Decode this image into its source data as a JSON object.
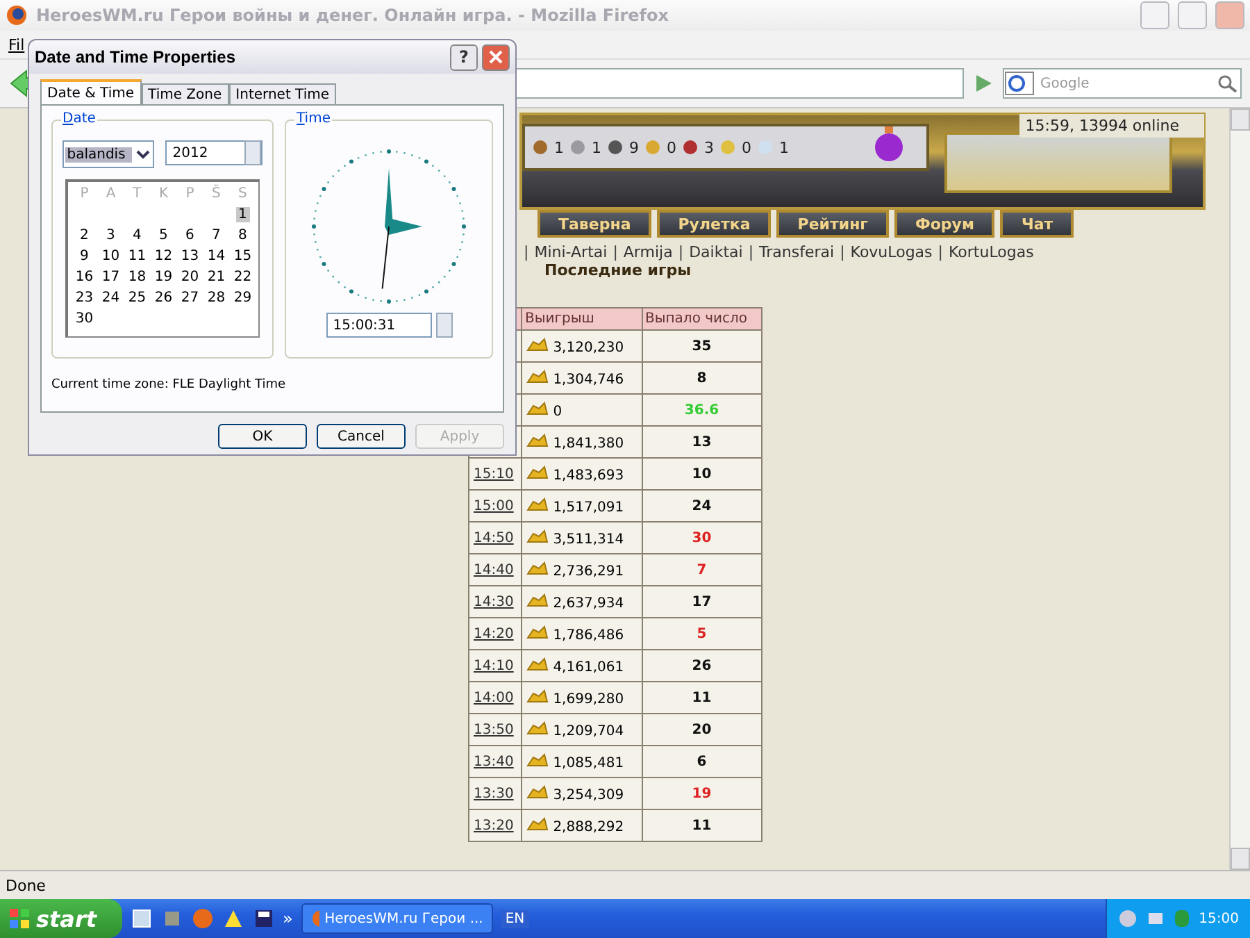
{
  "browser": {
    "title": "HeroesWM.ru Герои войны и денег. Онлайн игра. - Mozilla Firefox",
    "menu": [
      "Fil"
    ],
    "search": {
      "placeholder": "Google"
    },
    "status": "Done"
  },
  "site": {
    "resources": [
      "1",
      "1",
      "9",
      "0",
      "3",
      "0",
      "1"
    ],
    "online": "15:59, 13994 online",
    "nav": [
      "Таверна",
      "Рулетка",
      "Рейтинг",
      "Форум",
      "Чат"
    ],
    "link_separator": "|",
    "links": [
      "Mini-Artai",
      "Armija",
      "Daiktai",
      "Transferai",
      "KovuLogas",
      "KortuLogas"
    ],
    "heading": "Последние игры",
    "table": {
      "columns": [
        "Выигрыш",
        "Выпало число"
      ],
      "rows": [
        {
          "prize": "3,120,230",
          "number": "35",
          "color": "#111111"
        },
        {
          "prize": "1,304,746",
          "number": "8",
          "color": "#111111"
        },
        {
          "prize": "0",
          "number": "36.6",
          "color": "#33cc33"
        },
        {
          "prize": "1,841,380",
          "number": "13",
          "color": "#111111"
        },
        {
          "time": "15:10",
          "prize": "1,483,693",
          "number": "10",
          "color": "#111111"
        },
        {
          "time": "15:00",
          "prize": "1,517,091",
          "number": "24",
          "color": "#111111"
        },
        {
          "time": "14:50",
          "prize": "3,511,314",
          "number": "30",
          "color": "#dd2222"
        },
        {
          "time": "14:40",
          "prize": "2,736,291",
          "number": "7",
          "color": "#dd2222"
        },
        {
          "time": "14:30",
          "prize": "2,637,934",
          "number": "17",
          "color": "#111111"
        },
        {
          "time": "14:20",
          "prize": "1,786,486",
          "number": "5",
          "color": "#dd2222"
        },
        {
          "time": "14:10",
          "prize": "4,161,061",
          "number": "26",
          "color": "#111111"
        },
        {
          "time": "14:00",
          "prize": "1,699,280",
          "number": "11",
          "color": "#111111"
        },
        {
          "time": "13:50",
          "prize": "1,209,704",
          "number": "20",
          "color": "#111111"
        },
        {
          "time": "13:40",
          "prize": "1,085,481",
          "number": "6",
          "color": "#111111"
        },
        {
          "time": "13:30",
          "prize": "3,254,309",
          "number": "19",
          "color": "#dd2222"
        },
        {
          "time": "13:20",
          "prize": "2,888,292",
          "number": "11",
          "color": "#111111"
        }
      ]
    }
  },
  "dialog": {
    "title": "Date and Time Properties",
    "help": "?",
    "tabs": [
      {
        "label": "Date & Time",
        "selected": true
      },
      {
        "label": "Time Zone",
        "selected": false
      },
      {
        "label": "Internet Time",
        "selected": false
      }
    ],
    "date_group": "Date",
    "month": "balandis",
    "year": "2012",
    "weekdays": [
      "P",
      "A",
      "T",
      "K",
      "P",
      "Š",
      "S"
    ],
    "weeks": [
      [
        {
          "label": "1",
          "selected": true
        }
      ],
      [
        {
          "label": "2",
          "selected": false
        },
        {
          "label": "3",
          "selected": false
        },
        {
          "label": "4",
          "selected": false
        },
        {
          "label": "5",
          "selected": false
        },
        {
          "label": "6",
          "selected": false
        },
        {
          "label": "7",
          "selected": false
        },
        {
          "label": "8",
          "selected": false
        }
      ],
      [
        {
          "label": "9",
          "selected": false
        },
        {
          "label": "10",
          "selected": false
        },
        {
          "label": "11",
          "selected": false
        },
        {
          "label": "12",
          "selected": false
        },
        {
          "label": "13",
          "selected": false
        },
        {
          "label": "14",
          "selected": false
        },
        {
          "label": "15",
          "selected": false
        }
      ],
      [
        {
          "label": "16",
          "selected": false
        },
        {
          "label": "17",
          "selected": false
        },
        {
          "label": "18",
          "selected": false
        },
        {
          "label": "19",
          "selected": false
        },
        {
          "label": "20",
          "selected": false
        },
        {
          "label": "21",
          "selected": false
        },
        {
          "label": "22",
          "selected": false
        }
      ],
      [
        {
          "label": "23",
          "selected": false
        },
        {
          "label": "24",
          "selected": false
        },
        {
          "label": "25",
          "selected": false
        },
        {
          "label": "26",
          "selected": false
        },
        {
          "label": "27",
          "selected": false
        },
        {
          "label": "28",
          "selected": false
        },
        {
          "label": "29",
          "selected": false
        }
      ],
      [
        {
          "label": "30",
          "selected": false
        }
      ]
    ],
    "time_group": "Time",
    "time": "15:00:31",
    "timezone": "Current time zone:  FLE Daylight Time",
    "buttons": [
      {
        "label": "OK",
        "disabled": false
      },
      {
        "label": "Cancel",
        "disabled": false
      },
      {
        "label": "Apply",
        "disabled": true
      }
    ]
  },
  "taskbar": {
    "start": "start",
    "overflow": "»",
    "task": "HeroesWM.ru Герои ...",
    "language": "EN",
    "clock": "15:00"
  }
}
